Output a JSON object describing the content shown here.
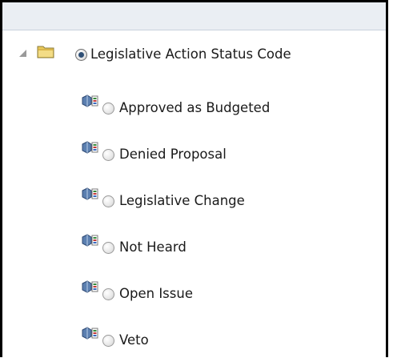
{
  "tree": {
    "root": {
      "label": "Legislative Action Status Code",
      "selected": true,
      "expanded": true,
      "folder_icon": "folder-icon",
      "expander_icon": "expanded-triangle-icon"
    },
    "children": [
      {
        "label": "Approved as Budgeted",
        "selected": false,
        "icon": "member-icon"
      },
      {
        "label": "Denied Proposal",
        "selected": false,
        "icon": "member-icon"
      },
      {
        "label": "Legislative Change",
        "selected": false,
        "icon": "member-icon"
      },
      {
        "label": "Not Heard",
        "selected": false,
        "icon": "member-icon"
      },
      {
        "label": "Open Issue",
        "selected": false,
        "icon": "member-icon"
      },
      {
        "label": "Veto",
        "selected": false,
        "icon": "member-icon"
      }
    ]
  },
  "colors": {
    "header_band": "#eaeef3",
    "folder": "#e9c95a",
    "radio_dot": "#2f4f75",
    "frame": "#000000"
  }
}
